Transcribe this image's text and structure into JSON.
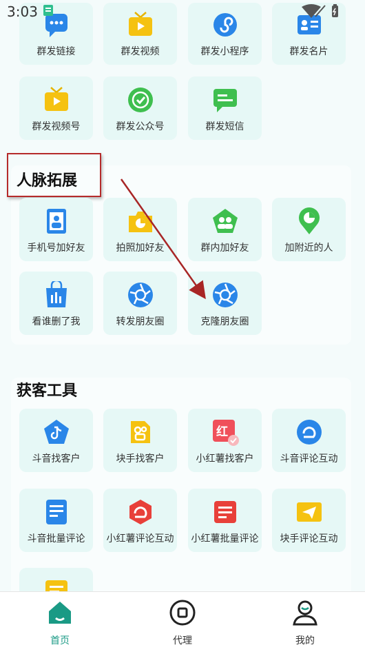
{
  "status_bar": {
    "time": "3:03"
  },
  "groups": [
    {
      "label": "群发链接",
      "icon": "chat-link-icon"
    },
    {
      "label": "群发视频",
      "icon": "tv-play-icon"
    },
    {
      "label": "群发小程序",
      "icon": "mini-program-icon"
    },
    {
      "label": "群发名片",
      "icon": "business-card-icon"
    },
    {
      "label": "群发视频号",
      "icon": "tv-play-icon"
    },
    {
      "label": "群发公众号",
      "icon": "official-account-icon"
    },
    {
      "label": "群发短信",
      "icon": "sms-icon"
    }
  ],
  "network": {
    "title": "人脉拓展",
    "items": [
      {
        "label": "手机号加好友",
        "icon": "phone-contact-icon"
      },
      {
        "label": "拍照加好友",
        "icon": "camera-icon"
      },
      {
        "label": "群内加好友",
        "icon": "group-users-icon"
      },
      {
        "label": "加附近的人",
        "icon": "location-pin-icon"
      },
      {
        "label": "看谁删了我",
        "icon": "bag-chart-icon"
      },
      {
        "label": "转发朋友圈",
        "icon": "moments-aperture-icon"
      },
      {
        "label": "克隆朋友圈",
        "icon": "moments-aperture-icon"
      }
    ]
  },
  "acquisition": {
    "title": "获客工具",
    "items": [
      {
        "label": "斗音找客户",
        "icon": "douyin-icon"
      },
      {
        "label": "块手找客户",
        "icon": "kuaishou-icon"
      },
      {
        "label": "小红薯找客户",
        "icon": "xiaohongshu-icon"
      },
      {
        "label": "斗音评论互动",
        "icon": "douyin-comment-icon"
      },
      {
        "label": "斗音批量评论",
        "icon": "document-icon"
      },
      {
        "label": "小红薯评论互动",
        "icon": "hexagon-comment-icon"
      },
      {
        "label": "小红薯批量评论",
        "icon": "document-red-icon"
      },
      {
        "label": "块手评论互动",
        "icon": "send-icon"
      },
      {
        "label": "",
        "icon": "document-yellow-icon"
      }
    ]
  },
  "tabbar": [
    {
      "label": "首页",
      "icon": "home-icon",
      "active": true
    },
    {
      "label": "代理",
      "icon": "agent-icon",
      "active": false
    },
    {
      "label": "我的",
      "icon": "profile-icon",
      "active": false
    }
  ],
  "colors": {
    "accent": "#1a9a85",
    "highlight_box": "#b52a2a",
    "tile_bg": "#e6f8f6"
  }
}
